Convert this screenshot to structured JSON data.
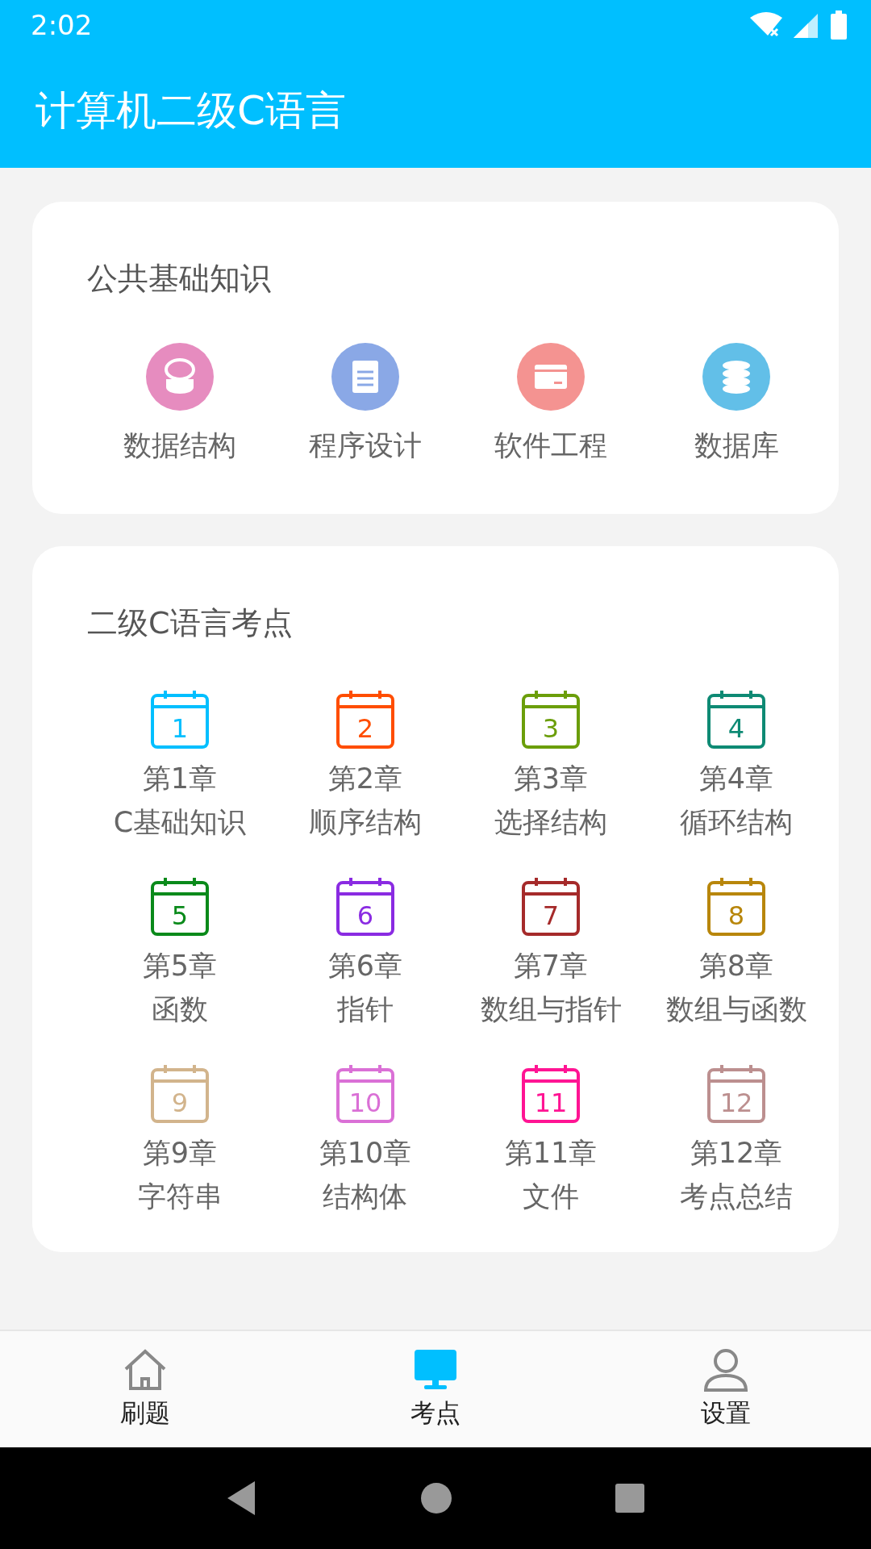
{
  "status_bar": {
    "time": "2:02"
  },
  "app_bar": {
    "title": "计算机二级C语言"
  },
  "public_section": {
    "title": "公共基础知识",
    "items": [
      {
        "label": "数据结构",
        "kind": "box",
        "color": "#e68cbf"
      },
      {
        "label": "程序设计",
        "kind": "notepad",
        "color": "#8aa8e6"
      },
      {
        "label": "软件工程",
        "kind": "card",
        "color": "#f49391"
      },
      {
        "label": "数据库",
        "kind": "database",
        "color": "#62bfe8"
      }
    ]
  },
  "chapter_section": {
    "title": "二级C语言考点",
    "chapters": [
      {
        "number": "1",
        "chapter": "第1章",
        "topic": "C基础知识",
        "color": "#00bfff"
      },
      {
        "number": "2",
        "chapter": "第2章",
        "topic": "顺序结构",
        "color": "#ff4d00"
      },
      {
        "number": "3",
        "chapter": "第3章",
        "topic": "选择结构",
        "color": "#6b9e0a"
      },
      {
        "number": "4",
        "chapter": "第4章",
        "topic": "循环结构",
        "color": "#0e8a74"
      },
      {
        "number": "5",
        "chapter": "第5章",
        "topic": "函数",
        "color": "#0a8a1a"
      },
      {
        "number": "6",
        "chapter": "第6章",
        "topic": "指针",
        "color": "#8a2be2"
      },
      {
        "number": "7",
        "chapter": "第7章",
        "topic": "数组与指针",
        "color": "#a52a2a"
      },
      {
        "number": "8",
        "chapter": "第8章",
        "topic": "数组与函数",
        "color": "#b8860b"
      },
      {
        "number": "9",
        "chapter": "第9章",
        "topic": "字符串",
        "color": "#d2b48c"
      },
      {
        "number": "10",
        "chapter": "第10章",
        "topic": "结构体",
        "color": "#da70d6"
      },
      {
        "number": "11",
        "chapter": "第11章",
        "topic": "文件",
        "color": "#ff1493"
      },
      {
        "number": "12",
        "chapter": "第12章",
        "topic": "考点总结",
        "color": "#bc8f8f"
      }
    ]
  },
  "bottom_nav": [
    {
      "label": "刷题",
      "kind": "home",
      "selected": false
    },
    {
      "label": "考点",
      "kind": "monitor",
      "selected": true
    },
    {
      "label": "设置",
      "kind": "user",
      "selected": false
    }
  ]
}
